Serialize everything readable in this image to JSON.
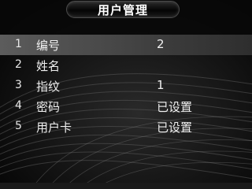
{
  "header": {
    "title": "用户管理"
  },
  "menu": {
    "selected_index": 0,
    "items": [
      {
        "number": "1",
        "label": "编号",
        "value": "2"
      },
      {
        "number": "2",
        "label": "姓名",
        "value": ""
      },
      {
        "number": "3",
        "label": "指纹",
        "value": "1"
      },
      {
        "number": "4",
        "label": "密码",
        "value": "已设置"
      },
      {
        "number": "5",
        "label": "用户卡",
        "value": "已设置"
      }
    ]
  }
}
